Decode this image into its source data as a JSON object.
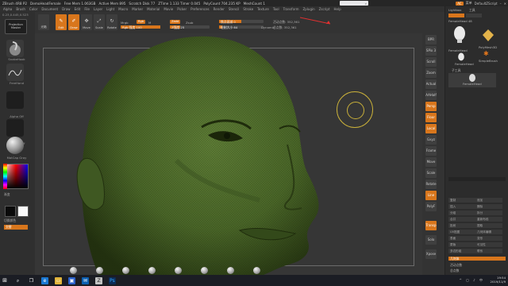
{
  "title_bar": {
    "items": [
      "ZBrush 4R8 P2",
      "DemoHeadFemale",
      "Free Mem 1.063GB",
      "Active Mem 895",
      "Scratch Disk 77",
      "ZTime 1.133 Timer 0.045",
      "PolyCount 704.235 KP",
      "MeshCount 1"
    ],
    "search_value": "",
    "right_items": [
      "菜单",
      "DefaultZScript"
    ],
    "badge": "AC"
  },
  "menu_bar": [
    "Alpha",
    "Brush",
    "Color",
    "Document",
    "Draw",
    "Edit",
    "File",
    "Layer",
    "Light",
    "Macro",
    "Marker",
    "Material",
    "Movie",
    "Picker",
    "Preferences",
    "Render",
    "Stencil",
    "Stroke",
    "Texture",
    "Tool",
    "Transform",
    "Zplugin",
    "Zscript",
    "Help"
  ],
  "left_panel": {
    "coords": "0.23,0.445,0.523",
    "projector": "Projection Master",
    "brush_label": "SnakeHook",
    "stroke_label": "FreeHand",
    "alpha_label": "Alpha Off",
    "texture_label": "Texture Off",
    "material_label": "MatCap Gray",
    "gradient_label": "渐变",
    "switch_label": "切换颜色",
    "alternate_label": "交替"
  },
  "top_shelf": {
    "buttons": [
      {
        "label": "光箱",
        "glyph": "",
        "active": false
      },
      {
        "label": "Edit",
        "glyph": "✎",
        "active": true
      },
      {
        "label": "Draw",
        "glyph": "✐",
        "active": true
      },
      {
        "label": "Move",
        "glyph": "✥",
        "active": false
      },
      {
        "label": "Scale",
        "glyph": "⤢",
        "active": false
      },
      {
        "label": "Rotate",
        "glyph": "↻",
        "active": false
      }
    ],
    "mrgb": "Mrgb",
    "rgb": "Rgb",
    "m": "M",
    "rgb_intensity": "Rgb 强度 100",
    "zadd": "Zadd",
    "zsub": "Zsub",
    "z_intensity": "Z强度 25",
    "focal_shift": "焦点衰减 0",
    "draw_size": "绘制大小 64",
    "dynamic": "Dynamic",
    "active_points": "活动点数: 352,361",
    "total_points": "总点数: 352,361",
    "rgb_intensity_value": 100,
    "z_intensity_value": 25,
    "focal_shift_value": 0,
    "draw_size_value": 64
  },
  "right_shelf": [
    {
      "label": "BPR",
      "active": false
    },
    {
      "label": "SPix 3",
      "active": false
    },
    {
      "label": "Scroll",
      "active": false
    },
    {
      "label": "Zoom",
      "active": false
    },
    {
      "label": "Actual",
      "active": false
    },
    {
      "label": "AAHalf",
      "active": false
    },
    {
      "label": "Persp",
      "active": true
    },
    {
      "label": "Floor",
      "active": true
    },
    {
      "label": "Local",
      "active": true
    },
    {
      "label": "Gxyz",
      "active": false
    },
    {
      "label": "Frame",
      "active": false
    },
    {
      "label": "Move",
      "active": false
    },
    {
      "label": "Scale",
      "active": false
    },
    {
      "label": "Rotate",
      "active": false
    },
    {
      "label": "Line Fill",
      "active": true
    },
    {
      "label": "PolyF",
      "active": false
    },
    {
      "label": "Transp",
      "active": true
    },
    {
      "label": "Solo",
      "active": false
    },
    {
      "label": "Xpose",
      "active": false
    }
  ],
  "tray": {
    "header": [
      "Lightbox",
      "工具"
    ],
    "current_tool": "FemaleHead 48",
    "tools": [
      "FemaleHead",
      "PolyMesh3D",
      "SimpleBrush",
      "FemaleHead"
    ],
    "subtool_title": "子工具",
    "subtool_item": "FemaleHead",
    "rows": [
      [
        "复制",
        "追加"
      ],
      [
        "插入",
        "删除"
      ],
      [
        "分组",
        "拆分"
      ],
      [
        "合并",
        "重新布线"
      ],
      [
        "投射",
        "提取"
      ],
      [
        "UV贴图",
        "几何体编辑"
      ],
      [
        "表面",
        "变形"
      ],
      [
        "蒙版",
        "可见性"
      ],
      [
        "多边形组",
        "联系"
      ]
    ],
    "geometry_label": "几何体",
    "active_pts": "活动点数",
    "total_pts": "总点数"
  },
  "taskbar": {
    "time": "19:54",
    "date": "2019/11/9",
    "app_icons": [
      "search",
      "taskview",
      "edge",
      "explorer",
      "store",
      "mail",
      "zbrush",
      "photoshop"
    ]
  },
  "colors": {
    "accent": "#d8761c",
    "mesh_green": "#4f6b2c",
    "background": "#2b2b2b"
  }
}
